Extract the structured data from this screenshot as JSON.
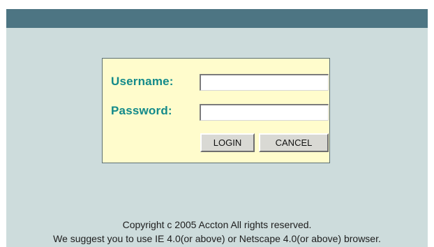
{
  "login": {
    "username_label": "Username:",
    "password_label": "Password:",
    "username_value": "",
    "password_value": "",
    "login_button": "LOGIN",
    "cancel_button": "CANCEL"
  },
  "footer": {
    "copyright": "Copyright c 2005 Accton All rights reserved.",
    "browser_notice": "We suggest you to use IE 4.0(or above) or Netscape 4.0(or above) browser."
  },
  "colors": {
    "header_bar": "#4d7583",
    "page_background": "#cddcdc",
    "login_box_background": "#fffccc",
    "label_text": "#138a8a"
  }
}
